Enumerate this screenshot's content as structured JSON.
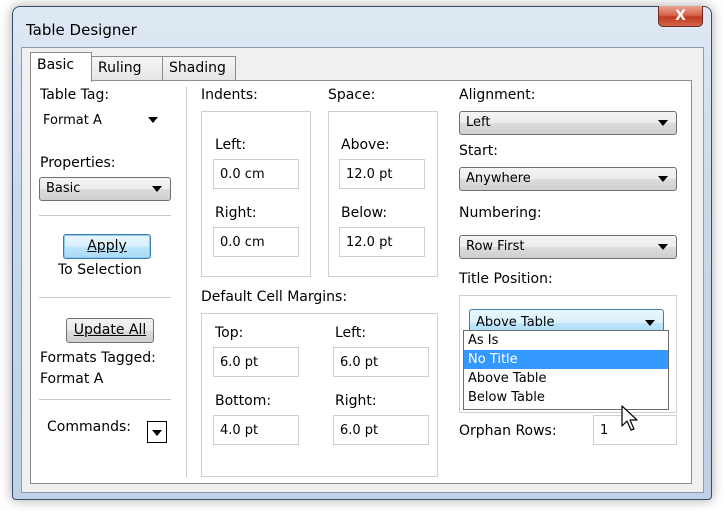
{
  "window": {
    "title": "Table Designer",
    "close_glyph": "X"
  },
  "tabs": [
    {
      "label": "Basic",
      "active": true
    },
    {
      "label": "Ruling",
      "active": false
    },
    {
      "label": "Shading",
      "active": false
    }
  ],
  "left": {
    "table_tag_label": "Table Tag:",
    "table_tag_value": "Format A",
    "properties_label": "Properties:",
    "properties_value": "Basic",
    "apply_label": "Apply",
    "to_selection": "To Selection",
    "update_all_label": "Update All",
    "formats_tagged": "Formats Tagged:",
    "formats_tagged_value": "Format A",
    "commands_label": "Commands:"
  },
  "indents": {
    "label": "Indents:",
    "left_label": "Left:",
    "left_value": "0.0 cm",
    "right_label": "Right:",
    "right_value": "0.0 cm"
  },
  "space": {
    "label": "Space:",
    "above_label": "Above:",
    "above_value": "12.0 pt",
    "below_label": "Below:",
    "below_value": "12.0 pt"
  },
  "margins": {
    "label": "Default Cell Margins:",
    "top_label": "Top:",
    "top_value": "6.0 pt",
    "left_label": "Left:",
    "left_value": "6.0 pt",
    "bottom_label": "Bottom:",
    "bottom_value": "4.0 pt",
    "right_label": "Right:",
    "right_value": "6.0 pt"
  },
  "right": {
    "alignment_label": "Alignment:",
    "alignment_value": "Left",
    "start_label": "Start:",
    "start_value": "Anywhere",
    "numbering_label": "Numbering:",
    "numbering_value": "Row First",
    "title_position_label": "Title Position:",
    "title_position_value": "Above Table",
    "title_position_options": [
      "As Is",
      "No Title",
      "Above Table",
      "Below Table"
    ],
    "title_position_highlighted": "No Title",
    "orphan_rows_label": "Orphan Rows:",
    "orphan_rows_value": "1"
  },
  "colors": {
    "selection": "#3399ff",
    "close_button": "#c23a1e"
  }
}
